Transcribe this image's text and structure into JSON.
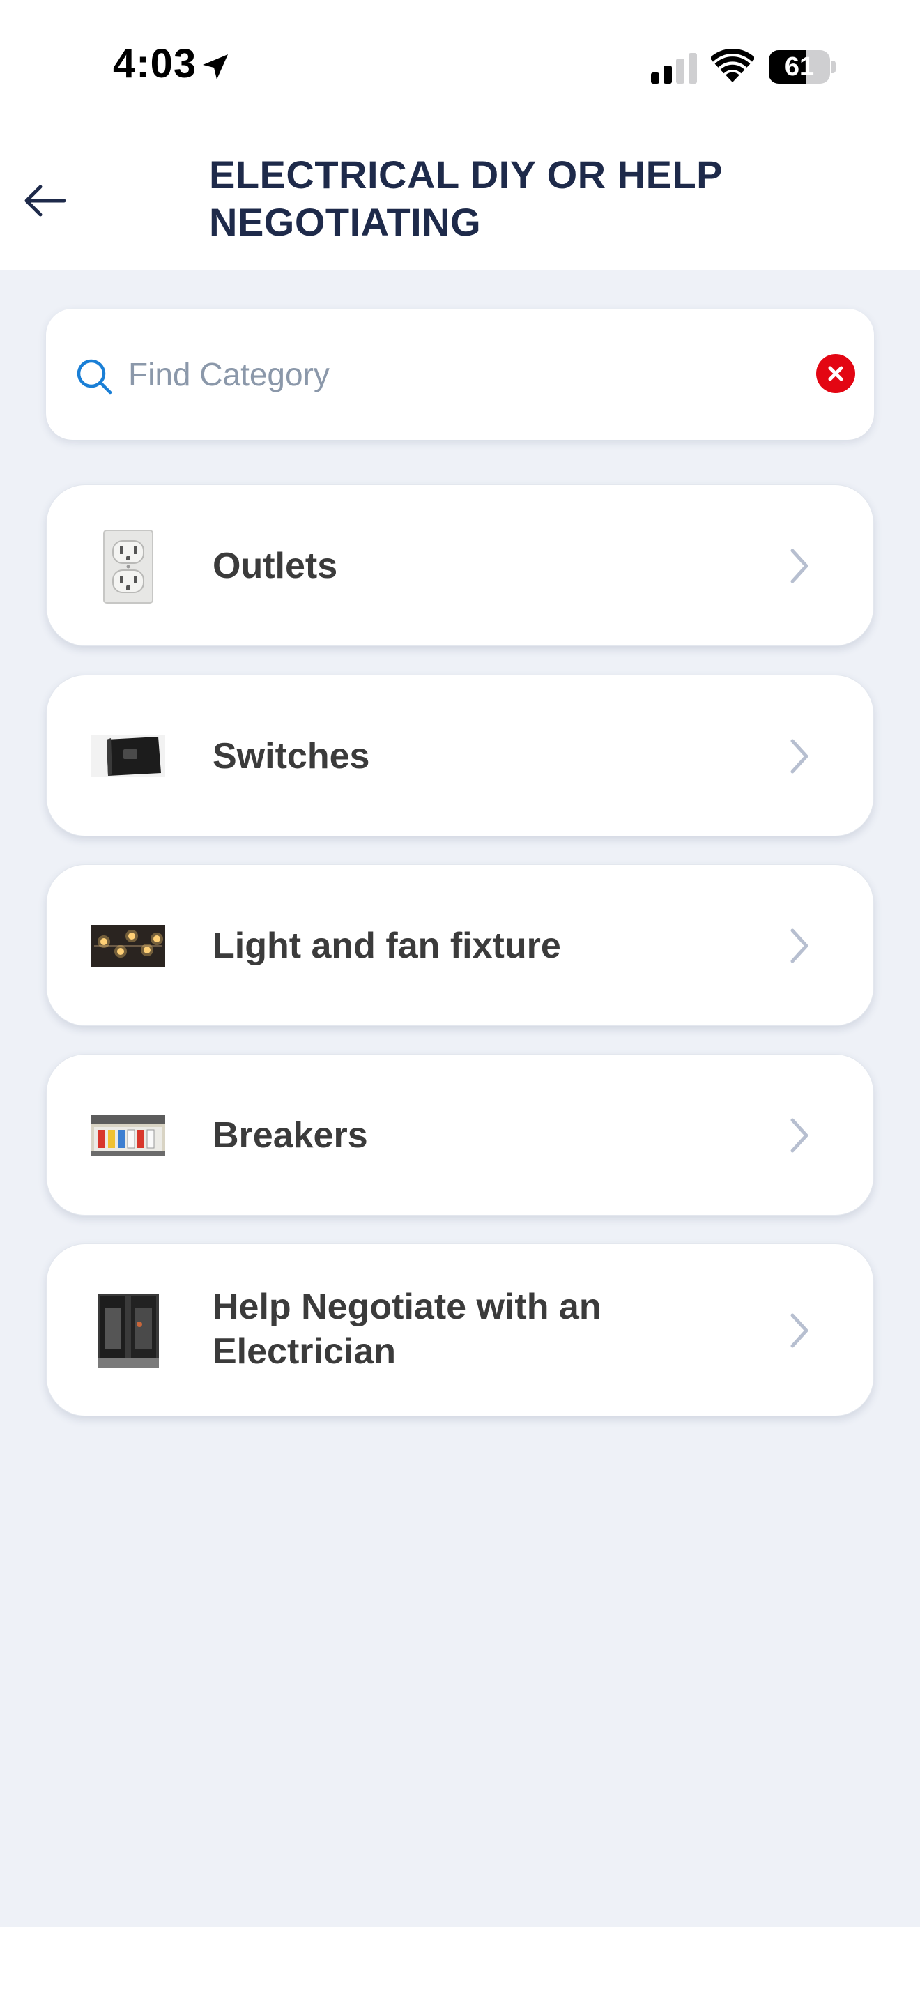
{
  "status_bar": {
    "time": "4:03",
    "battery": "61",
    "battery_level": 0.61,
    "icons": [
      "location-arrow-icon",
      "cellular-signal-icon",
      "wifi-icon",
      "battery-icon"
    ]
  },
  "header": {
    "title": "ELECTRICAL DIY OR HELP NEGOTIATING",
    "back_icon": "arrow-left-icon"
  },
  "search": {
    "placeholder": "Find Category",
    "value": "",
    "icon": "search-icon",
    "clear_icon": "clear-x-icon"
  },
  "categories": [
    {
      "label": "Outlets",
      "thumb": "outlet-image"
    },
    {
      "label": "Switches",
      "thumb": "switch-image"
    },
    {
      "label": "Light and fan fixture",
      "thumb": "light-fixture-image"
    },
    {
      "label": "Breakers",
      "thumb": "breaker-panel-image"
    },
    {
      "label": "Help Negotiate with an Electrician",
      "thumb": "electrician-panel-image"
    }
  ],
  "colors": {
    "title": "#1e2a4a",
    "background": "#eef1f7",
    "card": "#ffffff",
    "accent": "#1a7fd6",
    "clear": "#e30613",
    "chevron": "#b7bfd0"
  }
}
